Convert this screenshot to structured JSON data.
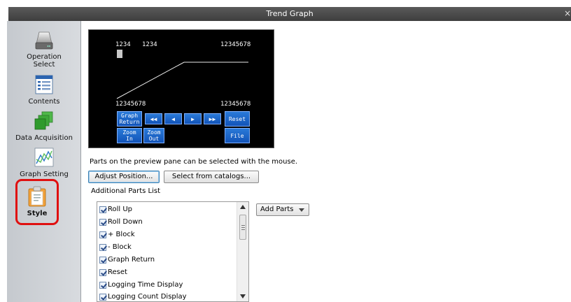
{
  "window": {
    "title": "Trend Graph",
    "close": "×"
  },
  "sidebar": {
    "items": [
      {
        "label": "Operation\nSelect",
        "icon": "drive-icon"
      },
      {
        "label": "Contents",
        "icon": "list-icon"
      },
      {
        "label": "Data Acquisition",
        "icon": "stacked-squares-icon"
      },
      {
        "label": "Graph Setting",
        "icon": "chart-icon"
      },
      {
        "label": "Style",
        "icon": "clipboard-icon"
      }
    ]
  },
  "preview": {
    "top_left_a": "1234",
    "top_left_b": "1234",
    "top_right": "12345678",
    "bottom_left": "12345678",
    "bottom_right": "12345678",
    "buttons": {
      "graph_return": "Graph\nReturn",
      "rewind": "◀◀",
      "back": "◀",
      "forward": "▶",
      "fast_forward": "▶▶",
      "reset": "Reset",
      "zoom_in": "Zoom\nIn",
      "zoom_out": "Zoom\nOut",
      "file": "File"
    }
  },
  "hint": "Parts on the preview pane can be selected with the mouse.",
  "buttons": {
    "adjust_position": "Adjust Position...",
    "select_from_catalogs": "Select from catalogs..."
  },
  "additional_parts_label": "Additional Parts List",
  "add_parts_button": "Add Parts",
  "parts": [
    {
      "label": "Roll Up",
      "checked": true
    },
    {
      "label": "Roll Down",
      "checked": true
    },
    {
      "label": "+ Block",
      "checked": true
    },
    {
      "label": "- Block",
      "checked": true
    },
    {
      "label": "Graph Return",
      "checked": true
    },
    {
      "label": "Reset",
      "checked": true
    },
    {
      "label": "Logging Time Display",
      "checked": true
    },
    {
      "label": "Logging Count Display",
      "checked": true
    }
  ],
  "colors": {
    "highlight": "#e01010",
    "preview_button": "#1a65c9"
  }
}
